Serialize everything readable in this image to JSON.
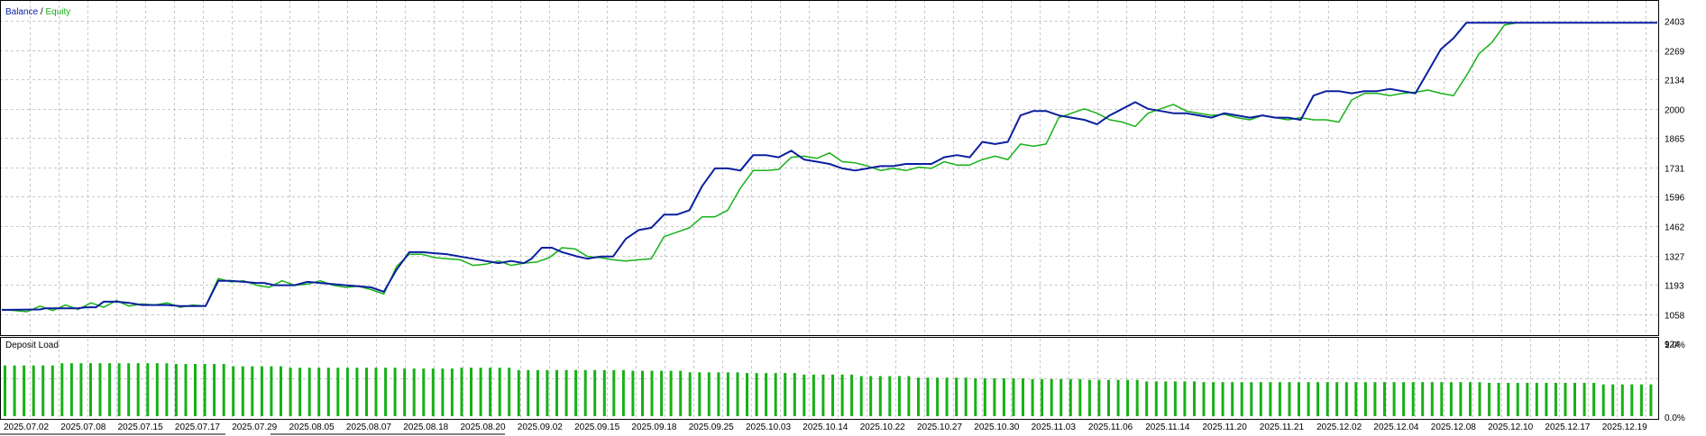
{
  "colors": {
    "balance": "#0b1f9e",
    "equity": "#17b117",
    "deposit_load": "#17b117",
    "grid": "#c8c8c8",
    "frame": "#000000",
    "background": "#ffffff"
  },
  "chart_data": [
    {
      "type": "line",
      "legend": {
        "balance_label": "Balance",
        "separator": " / ",
        "equity_label": "Equity",
        "placement": "top-left"
      },
      "y_ticks": [
        "2403",
        "2269",
        "2134",
        "2000",
        "1865",
        "1731",
        "1596",
        "1462",
        "1327",
        "1193",
        "1058",
        "924"
      ],
      "ylim": [
        924,
        2403
      ],
      "grid": true,
      "series": [
        {
          "name": "Balance",
          "x": [
            0,
            15,
            17,
            30,
            33,
            37,
            40,
            45,
            50,
            55,
            57,
            62,
            65,
            70,
            75,
            80,
            85,
            90,
            95,
            100,
            103,
            107,
            110,
            115,
            120,
            125,
            130,
            135,
            140,
            145,
            150,
            155,
            160,
            165,
            170,
            175,
            180,
            185,
            190,
            195,
            200,
            205,
            208,
            212,
            216,
            220,
            223,
            226,
            230,
            235,
            240,
            245,
            250,
            255,
            260,
            265,
            270,
            275,
            280,
            285,
            290,
            295,
            300,
            305,
            310,
            315,
            320,
            325,
            330,
            335,
            340,
            345,
            350,
            355,
            360,
            365,
            370,
            375,
            380,
            385,
            390,
            395,
            400,
            405,
            410,
            415,
            420,
            425,
            430,
            435,
            440,
            445,
            450,
            455,
            460,
            465,
            470,
            475,
            480,
            485,
            490,
            495,
            500,
            505,
            510,
            515,
            520,
            525,
            530,
            535,
            540,
            545,
            550,
            555,
            560,
            565,
            570,
            575,
            580,
            585,
            590,
            595,
            600,
            605,
            610,
            615,
            620,
            625,
            630,
            635,
            640,
            645,
            650
          ],
          "values": [
            1018,
            1020,
            1025,
            1025,
            1030,
            1030,
            1055,
            1055,
            1050,
            1040,
            1040,
            1040,
            1040,
            1035,
            1035,
            1035,
            1150,
            1150,
            1145,
            1140,
            1140,
            1130,
            1130,
            1130,
            1145,
            1140,
            1135,
            1130,
            1125,
            1120,
            1100,
            1200,
            1280,
            1280,
            1275,
            1270,
            1260,
            1250,
            1240,
            1230,
            1240,
            1230,
            1250,
            1300,
            1300,
            1280,
            1270,
            1260,
            1250,
            1260,
            1260,
            1340,
            1380,
            1390,
            1450,
            1450,
            1470,
            1580,
            1660,
            1660,
            1650,
            1720,
            1720,
            1710,
            1740,
            1700,
            1690,
            1680,
            1660,
            1650,
            1660,
            1670,
            1670,
            1680,
            1680,
            1680,
            1710,
            1720,
            1710,
            1780,
            1770,
            1780,
            1900,
            1920,
            1920,
            1900,
            1890,
            1880,
            1860,
            1900,
            1930,
            1960,
            1930,
            1920,
            1910,
            1910,
            1900,
            1890,
            1910,
            1900,
            1890,
            1900,
            1890,
            1890,
            1880,
            1990,
            2010,
            2010,
            2000,
            2010,
            2010,
            2020,
            2010,
            2000,
            2100,
            2200,
            2250,
            2320,
            2320,
            2320,
            2320,
            2320,
            2320,
            2320,
            2320,
            2320,
            2320,
            2320,
            2320,
            2320,
            2320,
            2320,
            2320
          ]
        },
        {
          "name": "Equity",
          "x": [
            0,
            10,
            15,
            20,
            25,
            30,
            35,
            40,
            45,
            50,
            55,
            60,
            65,
            70,
            75,
            80,
            85,
            90,
            95,
            100,
            105,
            110,
            115,
            120,
            125,
            130,
            135,
            140,
            145,
            150,
            155,
            160,
            165,
            170,
            175,
            180,
            185,
            190,
            195,
            200,
            205,
            210,
            215,
            220,
            225,
            230,
            235,
            240,
            245,
            250,
            255,
            260,
            265,
            270,
            275,
            280,
            285,
            290,
            295,
            300,
            305,
            310,
            315,
            320,
            325,
            330,
            335,
            340,
            345,
            350,
            355,
            360,
            365,
            370,
            375,
            380,
            385,
            390,
            395,
            400,
            405,
            410,
            415,
            420,
            425,
            430,
            435,
            440,
            445,
            450,
            455,
            460,
            465,
            470,
            475,
            480,
            485,
            490,
            495,
            500,
            505,
            510,
            515,
            520,
            525,
            530,
            535,
            540,
            545,
            550,
            555,
            560,
            565,
            570,
            575,
            580,
            585,
            590,
            595,
            600,
            605,
            610,
            615,
            620,
            625,
            630,
            635,
            640,
            645,
            650
          ],
          "values": [
            1020,
            1010,
            1035,
            1015,
            1040,
            1020,
            1050,
            1030,
            1060,
            1035,
            1045,
            1040,
            1050,
            1030,
            1040,
            1035,
            1160,
            1145,
            1150,
            1130,
            1120,
            1150,
            1130,
            1135,
            1150,
            1130,
            1120,
            1125,
            1110,
            1090,
            1215,
            1270,
            1270,
            1255,
            1250,
            1245,
            1220,
            1225,
            1240,
            1220,
            1230,
            1235,
            1255,
            1300,
            1295,
            1260,
            1255,
            1245,
            1240,
            1245,
            1250,
            1350,
            1370,
            1390,
            1440,
            1440,
            1470,
            1570,
            1650,
            1650,
            1655,
            1710,
            1715,
            1705,
            1730,
            1690,
            1685,
            1670,
            1650,
            1660,
            1650,
            1665,
            1660,
            1690,
            1675,
            1675,
            1700,
            1715,
            1700,
            1770,
            1760,
            1770,
            1890,
            1910,
            1930,
            1910,
            1880,
            1870,
            1850,
            1910,
            1930,
            1950,
            1920,
            1910,
            1900,
            1905,
            1890,
            1880,
            1900,
            1890,
            1880,
            1890,
            1880,
            1880,
            1870,
            1970,
            2000,
            2000,
            1990,
            2000,
            2005,
            2015,
            2000,
            1990,
            2080,
            2180,
            2230,
            2310,
            2320,
            2320,
            2320,
            2320,
            2320,
            2320,
            2320,
            2320,
            2320,
            2320,
            2320,
            2320
          ]
        }
      ]
    },
    {
      "type": "bar",
      "title": "Deposit Load",
      "y_ticks": [
        "1.0%",
        "0.0%"
      ],
      "ylim": [
        0,
        1.0
      ],
      "grid": true,
      "categories": [
        "2025.07.02",
        "2025.07.08",
        "2025.07.15",
        "2025.07.17",
        "2025.07.29",
        "2025.08.05",
        "2025.08.07",
        "2025.08.18",
        "2025.08.20",
        "2025.09.02",
        "2025.09.15",
        "2025.09.18",
        "2025.09.25",
        "2025.10.03",
        "2025.10.14",
        "2025.10.22",
        "2025.10.27",
        "2025.10.30",
        "2025.11.03",
        "2025.11.06",
        "2025.11.14",
        "2025.11.20",
        "2025.11.21",
        "2025.12.02",
        "2025.12.04",
        "2025.12.08",
        "2025.12.10",
        "2025.12.17",
        "2025.12.19"
      ],
      "values": [
        0.67,
        0.7,
        0.7,
        0.69,
        0.66,
        0.64,
        0.64,
        0.63,
        0.64,
        0.61,
        0.61,
        0.6,
        0.58,
        0.57,
        0.55,
        0.53,
        0.51,
        0.5,
        0.49,
        0.48,
        0.46,
        0.45,
        0.45,
        0.45,
        0.45,
        0.45,
        0.44,
        0.44,
        0.42
      ]
    }
  ]
}
